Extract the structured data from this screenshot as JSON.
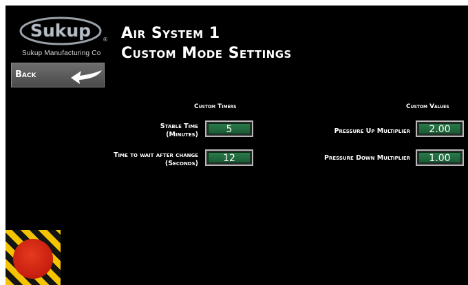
{
  "brand": {
    "name": "Sukup",
    "subtitle": "Sukup Manufacturing Co",
    "registered_mark": "®",
    "logo_color": "#9aa0a8"
  },
  "header": {
    "title_line1": "Air System 1",
    "title_line2": "Custom Mode Settings"
  },
  "nav": {
    "back_label": "Back",
    "back_icon": "arrow-left-icon"
  },
  "custom_timers": {
    "header": "Custom Timers",
    "stable_time": {
      "label_line1": "Stable Time",
      "label_line2": "(Minutes)",
      "value": "5"
    },
    "wait_time": {
      "label_line1": "Time to wait after change",
      "label_line2": "(Seconds)",
      "value": "12"
    }
  },
  "custom_values": {
    "header": "Custom Values",
    "pressure_up": {
      "label": "Pressure Up Multiplier",
      "value": "2.00"
    },
    "pressure_down": {
      "label": "Pressure Down Multiplier",
      "value": "1.00"
    }
  },
  "emergency_stop": {
    "icon": "emergency-stop-icon",
    "color": "#d62a14",
    "stripe_color": "#f5c400"
  },
  "colors": {
    "background": "#000000",
    "field_fill": "#226b40",
    "field_border": "#b8b8b8",
    "text": "#ffffff"
  }
}
